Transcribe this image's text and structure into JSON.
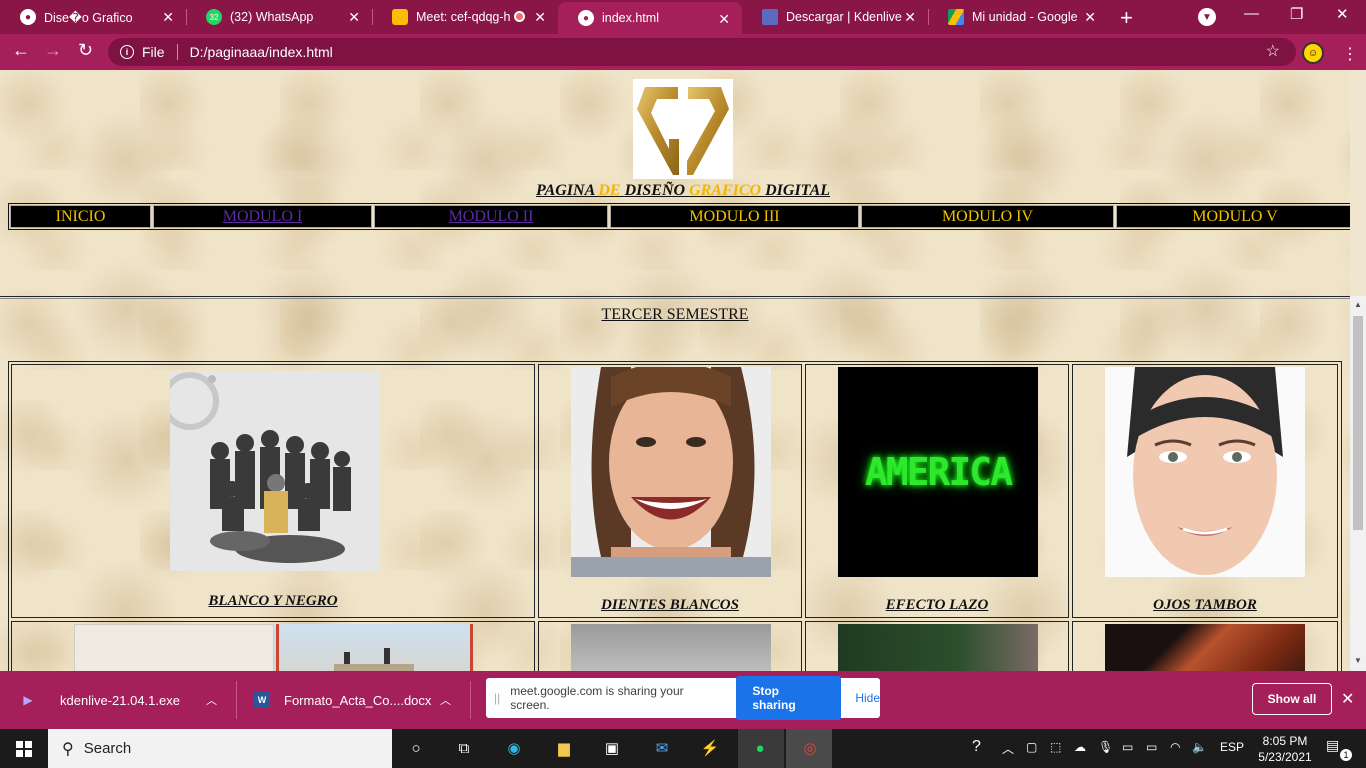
{
  "browser": {
    "tabs": [
      {
        "title": "Dise�o Grafico",
        "favicon": "globe-icon",
        "active": false
      },
      {
        "title": "(32) WhatsApp",
        "favicon": "whatsapp-icon",
        "badge": "32",
        "active": false
      },
      {
        "title": "Meet: cef-qdqg-h",
        "favicon": "meet-icon",
        "recording": true,
        "active": false
      },
      {
        "title": "index.html",
        "favicon": "globe-icon",
        "active": true
      },
      {
        "title": "Descargar | Kdenlive",
        "favicon": "kdenlive-icon",
        "active": false
      },
      {
        "title": "Mi unidad - Google Dr",
        "favicon": "drive-icon",
        "active": false
      }
    ],
    "new_tab": "+",
    "address": {
      "scheme": "File",
      "url": "D:/paginaaa/index.html"
    },
    "accent_color": "#a51f5a"
  },
  "site": {
    "logo_text": "GC",
    "title_words": [
      {
        "text": "PAGINA ",
        "highlight": false
      },
      {
        "text": "DE ",
        "highlight": true
      },
      {
        "text": "DISEÑO ",
        "highlight": false
      },
      {
        "text": "GRAFICO ",
        "highlight": true
      },
      {
        "text": "DIGITAL",
        "highlight": false
      }
    ],
    "nav": [
      "INICIO",
      "MODULO I",
      "MODULO II",
      "MODULO III",
      "MODULO IV",
      "MODULO V"
    ],
    "nav_visited": [
      false,
      true,
      true,
      false,
      false,
      false
    ],
    "semester": "TERCER SEMESTRE",
    "gallery": [
      {
        "caption": "BLANCO Y NEGRO",
        "image": "group-photo-bw"
      },
      {
        "caption": "DIENTES BLANCOS",
        "image": "smiling-woman"
      },
      {
        "caption": "EFECTO LAZO",
        "image": "america-neon-text",
        "image_text": "AMERICA"
      },
      {
        "caption": "OJOS TAMBOR",
        "image": "woman-face"
      }
    ]
  },
  "downloads": {
    "items": [
      {
        "name": "kdenlive-21.04.1.exe",
        "icon": "kdenlive-icon"
      },
      {
        "name": "Formato_Acta_Co....docx",
        "icon": "word-icon"
      }
    ],
    "share_message": "meet.google.com is sharing your screen.",
    "stop_label": "Stop sharing",
    "hide_label": "Hide",
    "show_all": "Show all"
  },
  "taskbar": {
    "search_placeholder": "Search",
    "language": "ESP",
    "time": "8:05 PM",
    "date": "5/23/2021",
    "notifications": "1"
  }
}
